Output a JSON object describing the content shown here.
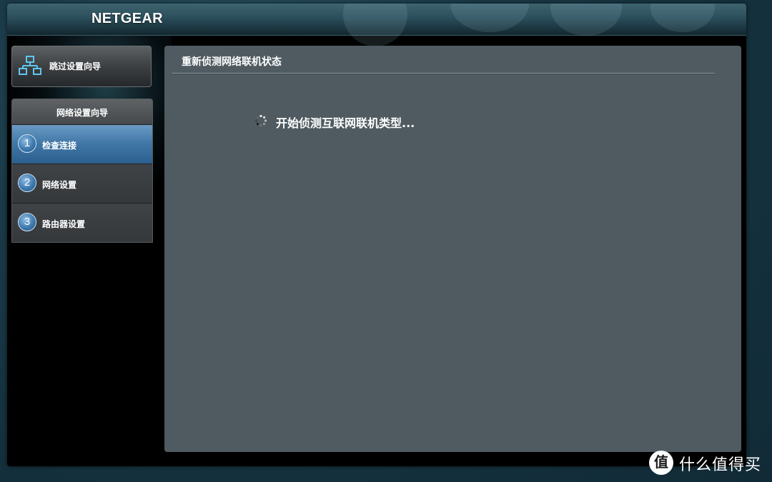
{
  "header": {
    "brand": "NETGEAR"
  },
  "sidebar": {
    "skip_button": {
      "label": "跳过设置向导",
      "icon": "network-topology-icon"
    },
    "wizard": {
      "title": "网络设置向导",
      "steps": [
        {
          "number": "1",
          "label": "检查连接",
          "active": true
        },
        {
          "number": "2",
          "label": "网络设置",
          "active": false
        },
        {
          "number": "3",
          "label": "路由器设置",
          "active": false
        }
      ]
    }
  },
  "main": {
    "heading": "重新侦测网络联机状态",
    "status": {
      "icon": "loading-spinner-icon",
      "text": "开始侦测互联网联机类型..."
    }
  },
  "watermark": {
    "badge": "值",
    "text": "什么值得买"
  },
  "colors": {
    "accent_step": "#3f76a6",
    "panel_bg": "#4f5b61",
    "page_bg": "#14303d"
  }
}
